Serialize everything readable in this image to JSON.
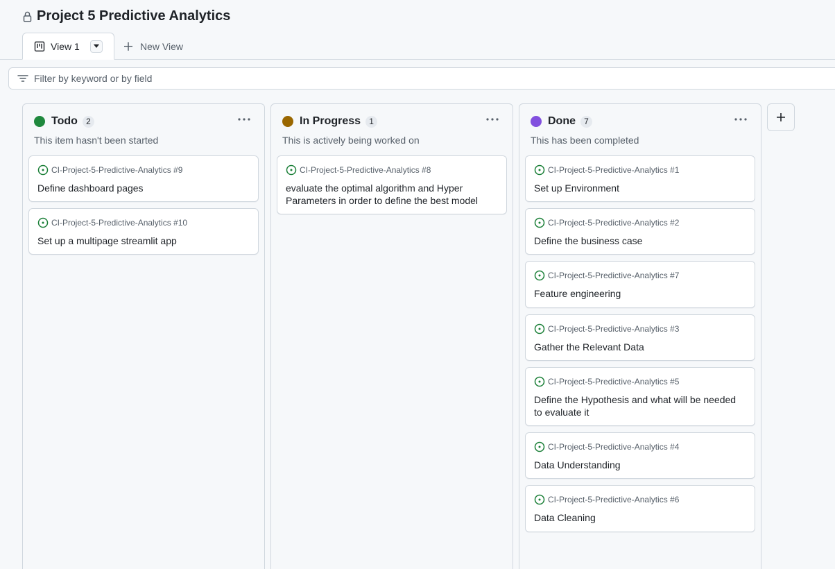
{
  "project": {
    "title": "Project 5 Predictive Analytics"
  },
  "tabs": {
    "active_label": "View 1",
    "new_view_label": "New View"
  },
  "filter": {
    "placeholder": "Filter by keyword or by field"
  },
  "columns": [
    {
      "name": "Todo",
      "count": "2",
      "description": "This item hasn't been started",
      "color": "#1f883d",
      "cards": [
        {
          "repo": "CI-Project-5-Predictive-Analytics #9",
          "title": "Define dashboard pages"
        },
        {
          "repo": "CI-Project-5-Predictive-Analytics #10",
          "title": "Set up a multipage streamlit app"
        }
      ]
    },
    {
      "name": "In Progress",
      "count": "1",
      "description": "This is actively being worked on",
      "color": "#9a6700",
      "cards": [
        {
          "repo": "CI-Project-5-Predictive-Analytics #8",
          "title": "evaluate the optimal algorithm and Hyper Parameters in order to define the best model"
        }
      ]
    },
    {
      "name": "Done",
      "count": "7",
      "description": "This has been completed",
      "color": "#8250df",
      "cards": [
        {
          "repo": "CI-Project-5-Predictive-Analytics #1",
          "title": "Set up Environment"
        },
        {
          "repo": "CI-Project-5-Predictive-Analytics #2",
          "title": "Define the business case"
        },
        {
          "repo": "CI-Project-5-Predictive-Analytics #7",
          "title": "Feature engineering"
        },
        {
          "repo": "CI-Project-5-Predictive-Analytics #3",
          "title": "Gather the Relevant Data"
        },
        {
          "repo": "CI-Project-5-Predictive-Analytics #5",
          "title": "Define the Hypothesis and what will be needed to evaluate it"
        },
        {
          "repo": "CI-Project-5-Predictive-Analytics #4",
          "title": "Data Understanding"
        },
        {
          "repo": "CI-Project-5-Predictive-Analytics #6",
          "title": "Data Cleaning"
        }
      ]
    }
  ],
  "icons": {
    "lock": "lock-icon",
    "board": "project-board-icon",
    "caret": "triangle-down-icon",
    "plus": "plus-icon",
    "filter": "filter-icon",
    "issue": "issue-opened-icon",
    "menu": "kebab-horizontal-icon"
  },
  "colors": {
    "issue_open": "#1a7f37",
    "border": "#d0d7de",
    "muted": "#57606a"
  }
}
